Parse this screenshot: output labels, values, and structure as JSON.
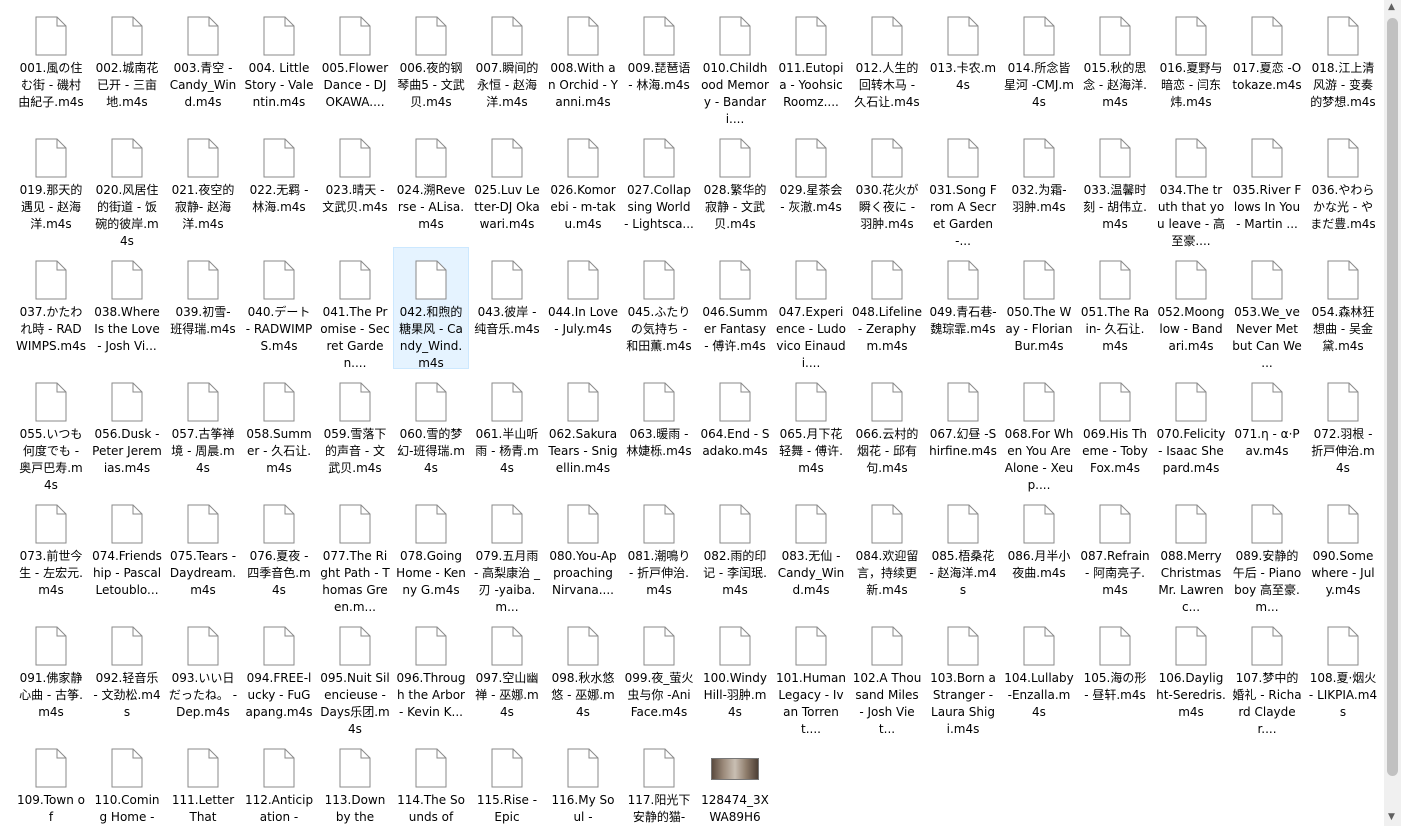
{
  "files": [
    "001.風の住む街 - 磯村由紀子.m4s",
    "002.城南花已开 - 三亩地.m4s",
    "003.青空 - Candy_Wind.m4s",
    "004. Little Story - Valentin.m4s",
    "005.Flower Dance - DJ OKAWA....",
    "006.夜的钢琴曲5 - 文武贝.m4s",
    "007.瞬间的永恒 - 赵海洋.m4s",
    "008.With an Orchid - Yanni.m4s",
    "009.琵琶语 - 林海.m4s",
    "010.Childhood Memory - Bandari....",
    "011.Eutopia - Yoohsic Roomz....",
    "012.人生的回转木马 - 久石让.m4s",
    "013.卡农.m4s",
    "014.所念皆星河 -CMJ.m4s",
    "015.秋的思念 - 赵海洋.m4s",
    "016.夏野与暗恋 - 闫东炜.m4s",
    "017.夏恋 -Otokaze.m4s",
    "018.江上清风游 - 变奏的梦想.m4s",
    "019.那天的遇见 - 赵海洋.m4s",
    "020.风居住的街道 - 饭碗的彼岸.m4s",
    "021.夜空的寂静- 赵海洋.m4s",
    "022.无羁 - 林海.m4s",
    "023.晴天 - 文武贝.m4s",
    "024.溯Reverse - ALisa.m4s",
    "025.Luv Letter-DJ Okawari.m4s",
    "026.Komorebi - m-taku.m4s",
    "027.Collapsing World - Lightsca...",
    "028.繁华的寂静 - 文武贝.m4s",
    "029.星茶会 - 灰澈.m4s",
    "030.花火が瞬く夜に - 羽肿.m4s",
    "031.Song From A Secret Garden-...",
    "032.为霜- 羽肿.m4s",
    "033.温馨时刻 - 胡伟立.m4s",
    "034.The truth that you leave - 高至豪....",
    "035.River Flows In You - Martin ...",
    "036.やわらかな光 - やまだ豊.m4s",
    "037.かたわれ時 - RADWIMPS.m4s",
    "038.Where Is the Love - Josh Vi...",
    "039.初雪- 班得瑞.m4s",
    "040.デート - RADWIMPS.m4s",
    "041.The Promise - Secret Garden....",
    "042.和煦的糖果风 - Candy_Wind.m4s",
    "043.彼岸 - 纯音乐.m4s",
    "044.In Love - July.m4s",
    "045.ふたりの気持ち - 和田薫.m4s",
    "046.Summer Fantasy - 傅许.m4s",
    "047.Experience - Ludovico Einaudi....",
    "048.Lifeline - Zeraphym.m4s",
    "049.青石巷-魏琮霏.m4s",
    "050.The Way - Florian Bur.m4s",
    "051.The Rain- 久石让.m4s",
    "052.Moonglow - Bandari.m4s",
    "053.We_ve Never Met but Can We ...",
    "054.森林狂想曲 - 吴金黛.m4s",
    "055.いつも何度でも - 奥戸巴寿.m4s",
    "056.Dusk - Peter Jeremias.m4s",
    "057.古筝禅境 - 周晨.m4s",
    "058.Summer - 久石让.m4s",
    "059.雪落下的声音 - 文武贝.m4s",
    "060.雪的梦幻-班得瑞.m4s",
    "061.半山听雨 - 杨青.m4s",
    "062.Sakura Tears - Snigellin.m4s",
    "063.暖雨 - 林婕栎.m4s",
    "064.End - Sadako.m4s",
    "065.月下花轻舞 - 傅许.m4s",
    "066.云村的烟花 - 邱有句.m4s",
    "067.幻昼 -Shirfine.m4s",
    "068.For When You Are Alone - Xeup....",
    "069.His Theme - Toby Fox.m4s",
    "070.Felicity - Isaac Shepard.m4s",
    "071.η - α·Pav.m4s",
    "072.羽根 - 折戸伸治.m4s",
    "073.前世今生 - 左宏元.m4s",
    "074.Friendship - Pascal Letoublo...",
    "075.Tears - Daydream.m4s",
    "076.夏夜 - 四季音色.m4s",
    "077.The Right Path - Thomas Green.m...",
    "078.Going Home - Kenny G.m4s",
    "079.五月雨 - 高梨康治 _刃 -yaiba.m...",
    "080.You-Approaching Nirvana....",
    "081.潮鳴り - 折戸伸治.m4s",
    "082.雨的印记 - 李闰珉.m4s",
    "083.无仙 - Candy_Wind.m4s",
    "084.欢迎留言，持续更新.m4s",
    "085.梧桑花 - 赵海洋.m4s",
    "086.月半小夜曲.m4s",
    "087.Refrain - 阿南亮子.m4s",
    "088.Merry Christmas Mr. Lawrenc...",
    "089.安静的午后 - Pianoboy 高至豪.m...",
    "090.Somewhere - July.m4s",
    "091.佛家静心曲 - 古筝.m4s",
    "092.轻音乐 - 文劲松.m4s",
    "093.いい日だったね。 - Dep.m4s",
    "094.FREE-lucky - FuGapang.m4s",
    "095.Nuit Silencieuse - Days乐团.m4s",
    "096.Through the Arbor - Kevin K...",
    "097.空山幽禅 - 巫娜.m4s",
    "098.秋水悠悠 - 巫娜.m4s",
    "099.夜_萤火虫与你 -AniFace.m4s",
    "100.Windy Hill-羽肿.m4s",
    "101.Human Legacy - Ivan Torrent....",
    "102.A Thousand Miles - Josh Viet...",
    "103.Born a Stranger - Laura Shigi.m4s",
    "104.Lullaby-Enzalla.m4s",
    "105.海の形 - 昼轩.m4s",
    "106.Daylight-Seredris.m4s",
    "107.梦中的婚礼 - Richard Clayder....",
    "108.夏·烟火 - LIKPIA.m4s",
    "109.Town of",
    "110.Coming Home -",
    "111.Letter That",
    "112.Anticipation -",
    "113.Down by the",
    "114.The Sounds of",
    "115.Rise - Epic",
    "116.My Soul -",
    "117.阳光下安静的猫-",
    "128474_3XWA89H6"
  ],
  "selected_index": 41,
  "thumbnail_index": 117,
  "scrollbar": {
    "up_glyph": "▲",
    "down_glyph": "▼"
  }
}
